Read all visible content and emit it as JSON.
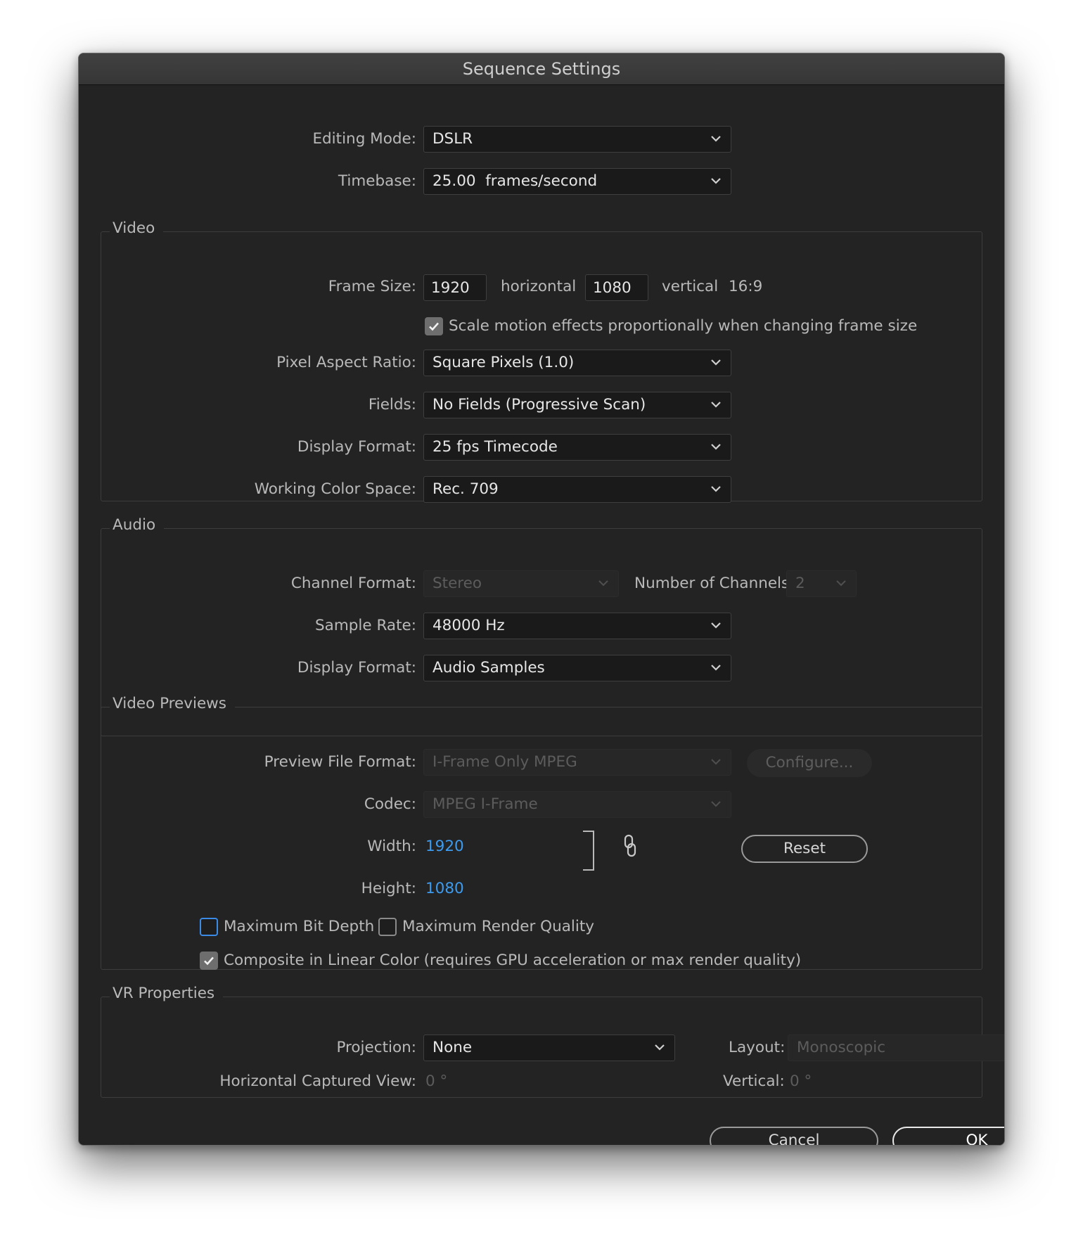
{
  "window": {
    "title": "Sequence Settings"
  },
  "editing_mode": {
    "label": "Editing Mode:",
    "value": "DSLR"
  },
  "timebase": {
    "label": "Timebase:",
    "value": "25.00  frames/second"
  },
  "video": {
    "title": "Video",
    "frame_size_label": "Frame Size:",
    "horizontal_value": "1920",
    "horizontal_label": "horizontal",
    "vertical_value": "1080",
    "vertical_label": "vertical",
    "aspect": "16:9",
    "scale_motion_label": "Scale motion effects proportionally when changing frame size",
    "scale_motion_checked": true,
    "pixel_aspect_label": "Pixel Aspect Ratio:",
    "pixel_aspect_value": "Square Pixels (1.0)",
    "fields_label": "Fields:",
    "fields_value": "No Fields (Progressive Scan)",
    "display_format_label": "Display Format:",
    "display_format_value": "25 fps Timecode",
    "color_space_label": "Working Color Space:",
    "color_space_value": "Rec. 709"
  },
  "audio": {
    "title": "Audio",
    "channel_format_label": "Channel Format:",
    "channel_format_value": "Stereo",
    "num_channels_label": "Number of Channels:",
    "num_channels_value": "2",
    "sample_rate_label": "Sample Rate:",
    "sample_rate_value": "48000 Hz",
    "display_format_label": "Display Format:",
    "display_format_value": "Audio Samples"
  },
  "previews": {
    "title": "Video Previews",
    "file_format_label": "Preview File Format:",
    "file_format_value": "I-Frame Only MPEG",
    "configure_label": "Configure...",
    "codec_label": "Codec:",
    "codec_value": "MPEG I-Frame",
    "width_label": "Width:",
    "width_value": "1920",
    "height_label": "Height:",
    "height_value": "1080",
    "reset_label": "Reset",
    "max_bit_depth_label": "Maximum Bit Depth",
    "max_bit_depth_checked": false,
    "max_render_label": "Maximum Render Quality",
    "max_render_checked": false,
    "linear_color_label": "Composite in Linear Color (requires GPU acceleration or max render quality)",
    "linear_color_checked": true
  },
  "vr": {
    "title": "VR Properties",
    "projection_label": "Projection:",
    "projection_value": "None",
    "layout_label": "Layout:",
    "layout_value": "Monoscopic",
    "h_view_label": "Horizontal Captured View:",
    "h_view_value": "0 °",
    "v_label": "Vertical:",
    "v_value": "0 °"
  },
  "buttons": {
    "cancel": "Cancel",
    "ok": "OK"
  },
  "colors": {
    "background": "#232323",
    "accent_blue": "#3d9bef",
    "text": "#b9b9b9",
    "field": "#1a1a1a"
  },
  "icons": {
    "dropdown": "chevron-down-icon",
    "check": "check-icon",
    "link": "chain-link-icon"
  }
}
